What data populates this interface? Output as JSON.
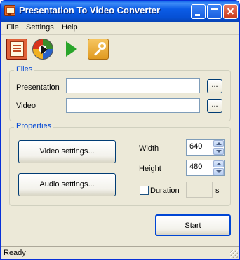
{
  "window": {
    "title": "Presentation To Video Converter"
  },
  "menu": {
    "items": [
      "File",
      "Settings",
      "Help"
    ]
  },
  "toolbar": {
    "icons": [
      "powerpoint-icon",
      "convert-icon",
      "play-icon",
      "key-icon"
    ]
  },
  "files": {
    "group_label": "Files",
    "presentation_label": "Presentation",
    "presentation_value": "",
    "video_label": "Video",
    "video_value": "",
    "browse_label": "..."
  },
  "properties": {
    "group_label": "Properties",
    "video_settings_label": "Video settings...",
    "audio_settings_label": "Audio settings...",
    "width_label": "Width",
    "width_value": "640",
    "height_label": "Height",
    "height_value": "480",
    "duration_label": "Duration",
    "duration_checked": false,
    "duration_value": "",
    "duration_unit": "s"
  },
  "actions": {
    "start_label": "Start"
  },
  "status": {
    "text": "Ready"
  },
  "colors": {
    "titlebar": "#0a5fe8",
    "group_label": "#0046d5",
    "window_bg": "#ece9d8"
  }
}
